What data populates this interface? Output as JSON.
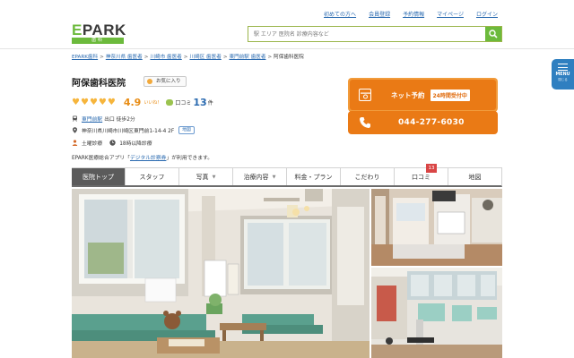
{
  "header": {
    "logo_text": "EPARK",
    "logo_sub": "歯科",
    "links": [
      "初めての方へ",
      "会員登録",
      "予約情報",
      "マイページ",
      "ログイン"
    ],
    "search_placeholder": "駅 エリア 医院名 診療内容など"
  },
  "breadcrumb": [
    {
      "label": "EPARK歯科",
      "link": true
    },
    {
      "label": "神奈川県 歯医者",
      "link": true
    },
    {
      "label": "川崎市 歯医者",
      "link": true
    },
    {
      "label": "川崎区 歯医者",
      "link": true
    },
    {
      "label": "東門前駅 歯医者",
      "link": true
    },
    {
      "label": "阿保歯科医院",
      "link": false
    }
  ],
  "clinic": {
    "name": "阿保歯科医院",
    "favorite_label": "お気に入り",
    "rating": "4.9",
    "hearts": 5,
    "iine_label": "いいね！",
    "review_label": "口コミ",
    "review_count": "13",
    "review_unit": "件",
    "station": "東門前駅",
    "exit_walk": "出口 徒歩2分",
    "address": "神奈川県川崎市川崎区東門前1-14-4 2F",
    "map_label": "地図",
    "tags": [
      "土曜診療",
      "18時以降診療"
    ],
    "app_note_prefix": "EPARK医療総合アプリ「",
    "app_note_link": "デジタル診察券",
    "app_note_suffix": "」が利用できます。"
  },
  "booking": {
    "net_label": "ネット予約",
    "net_badge": "24時間受付中",
    "phone": "044-277-6030"
  },
  "sidemenu": {
    "label": "MENU",
    "sub": "閉じる"
  },
  "tabs": [
    {
      "label": "医院トップ",
      "active": true,
      "caret": false
    },
    {
      "label": "スタッフ",
      "active": false,
      "caret": false
    },
    {
      "label": "写真",
      "active": false,
      "caret": true
    },
    {
      "label": "治療内容",
      "active": false,
      "caret": true
    },
    {
      "label": "料金・プラン",
      "active": false,
      "caret": false
    },
    {
      "label": "こだわり",
      "active": false,
      "caret": false
    },
    {
      "label": "口コミ",
      "active": false,
      "caret": false,
      "badge": "13"
    },
    {
      "label": "地図",
      "active": false,
      "caret": false
    }
  ],
  "colors": {
    "brand_green": "#6cba3c",
    "accent_orange": "#ea7a15",
    "link_blue": "#2a6ab0",
    "menu_blue": "#2f7fc0"
  }
}
